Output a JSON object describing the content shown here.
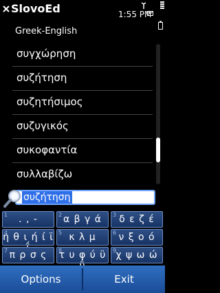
{
  "app": {
    "title": "SlovoEd",
    "close_icon": "close-icon"
  },
  "status": {
    "time": "1:55 PM"
  },
  "dictionary": {
    "name": "Greek-English"
  },
  "words": [
    "συγχώρηση",
    "συζήτηση",
    "συζητήσιμος",
    "συζυγικός",
    "συκοφαντία",
    "συλλαβίζω"
  ],
  "search": {
    "value": "συζήτηση",
    "icon": "magnifier-icon"
  },
  "keypad": [
    {
      "num": "1",
      "label": ". , -"
    },
    {
      "num": "2",
      "label": "α β γ ά"
    },
    {
      "num": "3",
      "label": "δ ε ζ έ"
    },
    {
      "num": "4",
      "label": "η θ ι ή ί ϊ ΐ"
    },
    {
      "num": "5",
      "label": "κ λ μ"
    },
    {
      "num": "6",
      "label": "ν ξ ο ό"
    },
    {
      "num": "7",
      "label": "π ρ σ ς"
    },
    {
      "num": "8",
      "label": "τ υ φ ύ ϋ ΰ"
    },
    {
      "num": "9",
      "label": "χ ψ ω ώ"
    }
  ],
  "softkeys": {
    "left": "Options",
    "right": "Exit"
  },
  "colors": {
    "accent": "#2f6fc1",
    "key_bg": "#1f3f77",
    "selection": "#2f6fe8"
  }
}
